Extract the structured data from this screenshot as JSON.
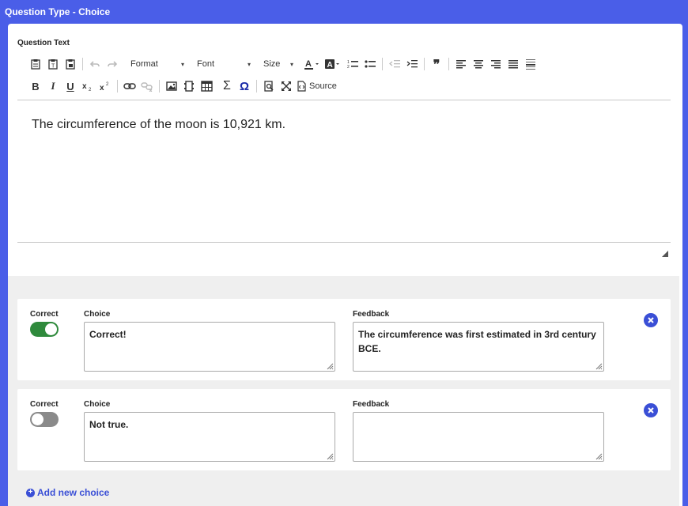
{
  "header": {
    "title": "Question Type - Choice"
  },
  "question": {
    "label": "Question Text",
    "text": "The circumference of the moon is 10,921 km."
  },
  "toolbar": {
    "format_label": "Format",
    "font_label": "Font",
    "size_label": "Size",
    "source_label": "Source",
    "bold": "B",
    "italic": "I",
    "underline": "U",
    "quote": "❞",
    "sigma": "Σ",
    "omega": "Ω"
  },
  "choices": [
    {
      "correct_label": "Correct",
      "correct": true,
      "choice_label": "Choice",
      "choice_text": "Correct!",
      "feedback_label": "Feedback",
      "feedback_text": "The circumference was first estimated in 3rd century BCE."
    },
    {
      "correct_label": "Correct",
      "correct": false,
      "choice_label": "Choice",
      "choice_text": "Not true.",
      "feedback_label": "Feedback",
      "feedback_text": ""
    }
  ],
  "add_choice_label": "Add new choice",
  "colors": {
    "accent": "#3a4fd6",
    "header_bg": "#4a5ee8",
    "toggle_on": "#2f8a3c",
    "toggle_off": "#8a8a8a"
  }
}
